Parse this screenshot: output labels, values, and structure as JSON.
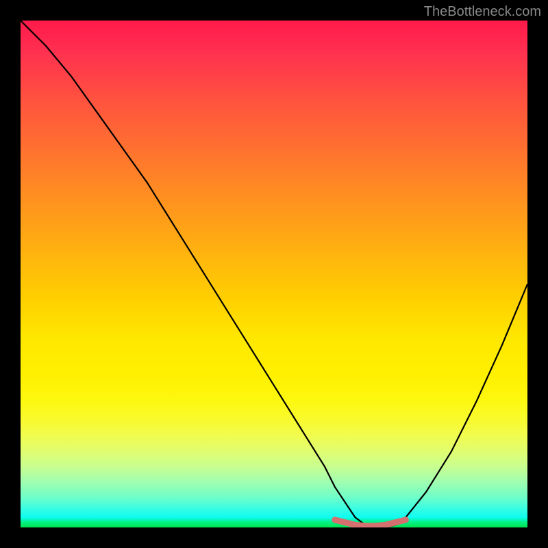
{
  "watermark": "TheBottleneck.com",
  "chart_data": {
    "type": "line",
    "title": "",
    "xlabel": "",
    "ylabel": "",
    "xlim": [
      0,
      100
    ],
    "ylim": [
      0,
      100
    ],
    "grid": false,
    "series": [
      {
        "name": "bottleneck-curve",
        "x": [
          0,
          5,
          10,
          15,
          20,
          25,
          30,
          35,
          40,
          45,
          50,
          55,
          60,
          62,
          64,
          66,
          68,
          70,
          72,
          74,
          76,
          80,
          85,
          90,
          95,
          100
        ],
        "values": [
          100,
          95,
          89,
          82,
          75,
          68,
          60,
          52,
          44,
          36,
          28,
          20,
          12,
          8,
          5,
          2,
          0.5,
          0,
          0,
          0.5,
          2,
          7,
          15,
          25,
          36,
          48
        ],
        "color": "#000000"
      },
      {
        "name": "optimal-flat-region",
        "x": [
          62,
          64,
          66,
          68,
          70,
          72,
          74,
          76
        ],
        "values": [
          1.5,
          1,
          0.5,
          0.3,
          0.3,
          0.5,
          1,
          1.5
        ],
        "color": "#d47070",
        "stroke_width": 6
      }
    ],
    "gradient_colors": {
      "top": "#ff1a4a",
      "mid_high": "#ffd000",
      "mid_low": "#fff000",
      "bottom": "#00e050"
    }
  }
}
